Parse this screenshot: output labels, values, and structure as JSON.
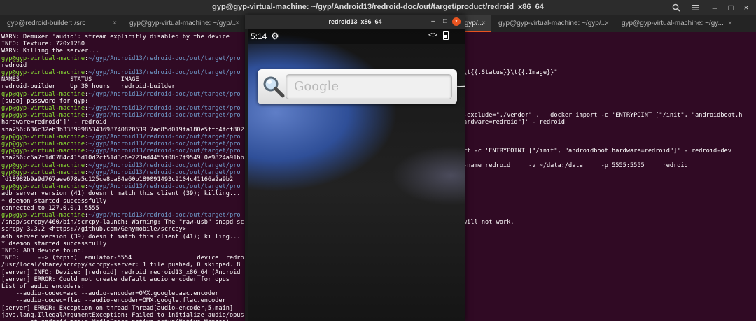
{
  "terminal_window": {
    "title": "gyp@gyp-virtual-machine: ~/gyp/Android13/redroid-doc/out/target/product/redroid_x86_64",
    "search_icon": "search-icon",
    "menu_icon": "hamburger-icon",
    "min_icon": "minimize-icon",
    "max_icon": "maximize-icon",
    "close_icon": "close-icon"
  },
  "tabs": [
    {
      "label": "gyp@redroid-builder: /src",
      "close": "×"
    },
    {
      "label": "gyp@gyp-virtual-machine: ~/gyp/...",
      "close": "×"
    },
    {
      "label": "gyp@gyp-virtual-machine: ~/gyp/...",
      "close": "×"
    },
    {
      "label": "gyp@gyp-virtual-machine: ~/gyp/...",
      "close": "×"
    },
    {
      "label": "gyp@gyp-virtual-machine: ~/gy...",
      "close": "×"
    }
  ],
  "terminal_lines": [
    {
      "plain": "WARN: Demuxer 'audio': stream explicitly disabled by the device"
    },
    {
      "plain": "INFO: Texture: 720x1280"
    },
    {
      "plain": "WARN: Killing the server..."
    },
    {
      "user": "gyp@gyp-virtual-machine",
      "path": "~/gyp/Android13/redroid-doc/out/target/pro"
    },
    {
      "plain": "redroid"
    },
    {
      "user": "gyp@gyp-virtual-machine",
      "path": "~/gyp/Android13/redroid-doc/out/target/pro"
    },
    {
      "plain": "NAMES              STATUS        IMAGE"
    },
    {
      "plain": "redroid-builder    Up 30 hours   redroid-builder"
    },
    {
      "user": "gyp@gyp-virtual-machine",
      "path": "~/gyp/Android13/redroid-doc/out/target/pro"
    },
    {
      "plain": "[sudo] password for gyp:"
    },
    {
      "user": "gyp@gyp-virtual-machine",
      "path": "~/gyp/Android13/redroid-doc/out/target/pro"
    },
    {
      "user": "gyp@gyp-virtual-machine",
      "path": "~/gyp/Android13/redroid-doc/out/target/pro"
    },
    {
      "plain": "hardware=redroid\"]' - redroid"
    },
    {
      "plain": "sha256:636c32eb3b33899985343698740820639 7ad85d019fa180e5ffc4fcf802"
    },
    {
      "user": "gyp@gyp-virtual-machine",
      "path": "~/gyp/Android13/redroid-doc/out/target/pro"
    },
    {
      "user": "gyp@gyp-virtual-machine",
      "path": "~/gyp/Android13/redroid-doc/out/target/pro"
    },
    {
      "user": "gyp@gyp-virtual-machine",
      "path": "~/gyp/Android13/redroid-doc/out/target/pro"
    },
    {
      "plain": "sha256:c6a7f1d0784c415d10d2cf51d3c6e223ad4455f08d7f9549 0e9824a91bb"
    },
    {
      "user": "gyp@gyp-virtual-machine",
      "path": "~/gyp/Android13/redroid-doc/out/target/pro"
    },
    {
      "user": "gyp@gyp-virtual-machine",
      "path": "~/gyp/Android13/redroid-doc/out/target/pro"
    },
    {
      "plain": "fd18982b9a9d767aee678e5c125ce8ba84e60b189091493c9104c41166a2a9b2"
    },
    {
      "user": "gyp@gyp-virtual-machine",
      "path": "~/gyp/Android13/redroid-doc/out/target/pro"
    },
    {
      "plain": "adb server version (41) doesn't match this client (39); killing..."
    },
    {
      "plain": "* daemon started successfully"
    },
    {
      "plain": "connected to 127.0.0.1:5555"
    },
    {
      "user": "gyp@gyp-virtual-machine",
      "path": "~/gyp/Android13/redroid-doc/out/target/pro"
    },
    {
      "plain": "/snap/scrcpy/460/bin/scrcpy-launch: Warning: The \"raw-usb\" snapd sc"
    },
    {
      "plain": "scrcpy 3.3.2 <https://github.com/Genymobile/scrcpy>"
    },
    {
      "plain": "adb server version (39) doesn't match this client (41); killing..."
    },
    {
      "plain": "* daemon started successfully"
    },
    {
      "plain": "INFO: ADB device found:"
    },
    {
      "plain": "INFO:     --> (tcpip)  emulator-5554                  device  redro"
    },
    {
      "plain": "/usr/local/share/scrcpy/scrcpy-server: 1 file pushed, 0 skipped. 8"
    },
    {
      "plain": "[server] INFO: Device: [redroid] redroid redroid13_x86_64 (Android"
    },
    {
      "plain": "[server] ERROR: Could not create default audio encoder for opus"
    },
    {
      "plain": "List of audio encoders:"
    },
    {
      "plain": "    --audio-codec=aac --audio-encoder=OMX.google.aac.encoder"
    },
    {
      "plain": "    --audio-codec=flac --audio-encoder=OMX.google.flac.encoder"
    },
    {
      "plain": "[server] ERROR: Exception on thread Thread[audio-encoder,5,main]"
    },
    {
      "plain": "java.lang.IllegalArgumentException: Failed to initialize audio/opus"
    },
    {
      "plain": "        at android.media.MediaCodec.native_setup(Native Method)"
    }
  ],
  "right_lines": [
    {
      "row": 5,
      "text": "\\t{{.Status}}\\t{{.Image}}\""
    },
    {
      "row": 11,
      "text": "-exclude=\"./vendor\" . | docker import -c 'ENTRYPOINT [\"/init\", \"androidboot.h"
    },
    {
      "row": 12,
      "text": "ardware=redroid\"]' - redroid"
    },
    {
      "row": 16,
      "text": "rt -c 'ENTRYPOINT [\"/init\", \"androidboot.hardware=redroid\"]' - redroid-dev"
    },
    {
      "row": 18,
      "text": "-name redroid     -v ~/data:/data     -p 5555:5555     redroid"
    },
    {
      "row": 26,
      "text": "will not work."
    }
  ],
  "scrcpy": {
    "title": "redroid13_x86_64",
    "minimize": "–",
    "maximize": "□",
    "close": "×",
    "status_time": "5:14",
    "settings_icon": "gear-icon",
    "network_icon": "data-arrows-icon",
    "battery_icon": "battery-icon",
    "google_placeholder": "Google",
    "search_icon": "magnifier-icon"
  }
}
